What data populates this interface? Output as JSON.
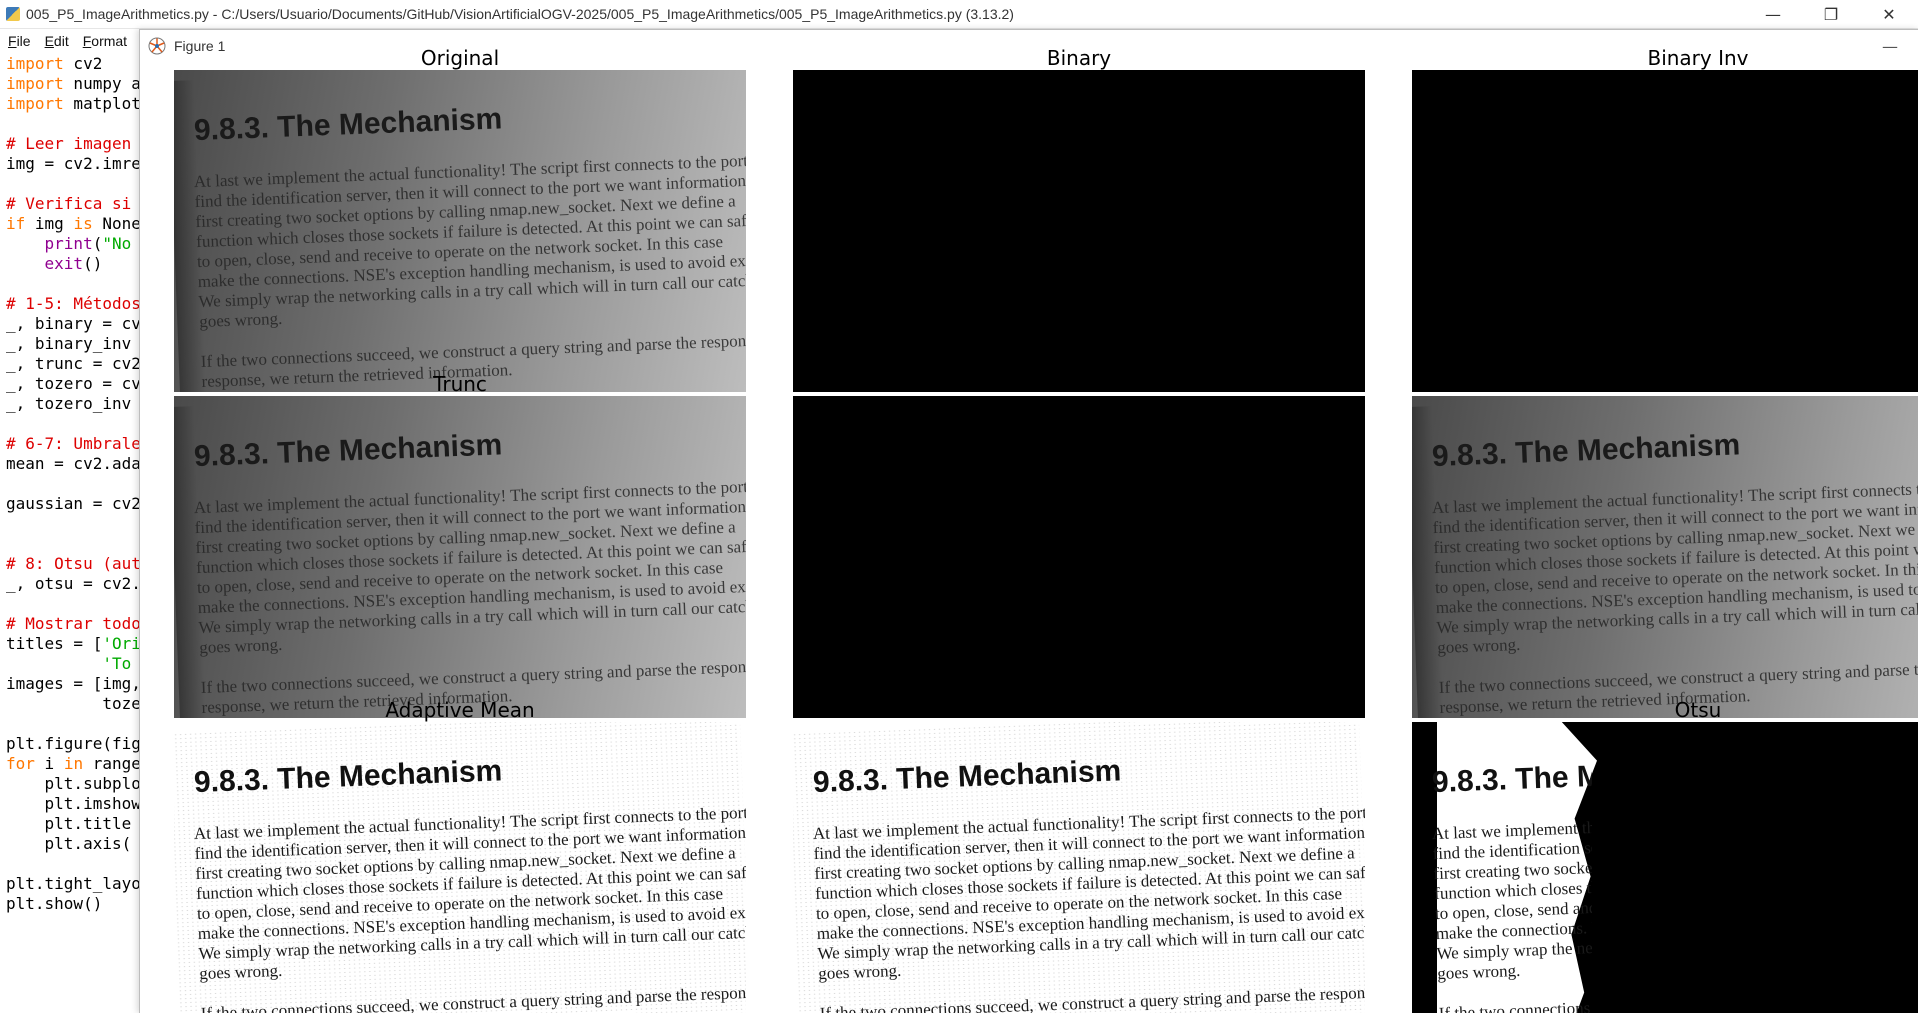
{
  "editor": {
    "title": "005_P5_ImageArithmetics.py - C:/Users/Usuario/Documents/GitHub/VisionArtificialOGV-2025/005_P5_ImageArithmetics/005_P5_ImageArithmetics.py (3.13.2)",
    "menu": [
      "File",
      "Edit",
      "Format"
    ],
    "controls": {
      "minimize": "—",
      "restore": "❐",
      "close": "✕"
    },
    "code": [
      {
        "kw": "import",
        "rest": " cv2"
      },
      {
        "kw": "import",
        "rest": " numpy a"
      },
      {
        "kw": "import",
        "rest": " matplot"
      },
      {
        "comment": "# Leer imagen"
      },
      {
        "text": "img = cv2.imre"
      },
      {
        "comment": "# Verifica si"
      },
      {
        "kw": "if",
        "rest": " img ",
        "kw2": "is",
        "rest2": " None"
      },
      {
        "indent": "    ",
        "bi": "print",
        "paren": "(",
        "str": "\"No"
      },
      {
        "indent": "    ",
        "bi": "exit",
        "rest": "()"
      },
      {
        "comment": "# 1-5: Métodos"
      },
      {
        "text": "_, binary = cv"
      },
      {
        "text": "_, binary_inv"
      },
      {
        "text": "_, trunc = cv2"
      },
      {
        "text": "_, tozero = cv"
      },
      {
        "text": "_, tozero_inv"
      },
      {
        "comment": "# 6-7: Umbrale"
      },
      {
        "text": "mean = cv2.ada"
      },
      {
        "text": "gaussian = cv2"
      },
      {
        "comment": "# 8: Otsu (aut"
      },
      {
        "text": "_, otsu = cv2."
      },
      {
        "comment": "# Mostrar todo"
      },
      {
        "text": "titles = [",
        "str": "'Ori"
      },
      {
        "indent": "          ",
        "str": "'To"
      },
      {
        "text": "images = [img,"
      },
      {
        "text": "          toze"
      },
      {
        "text": "plt.figure(fig"
      },
      {
        "kw": "for",
        "rest": " i ",
        "kw2": "in",
        "rest2": " range"
      },
      {
        "text": "    plt.subplo"
      },
      {
        "text": "    plt.imshow"
      },
      {
        "text": "    plt.title"
      },
      {
        "text": "    plt.axis("
      },
      {
        "text": "plt.tight_layo"
      },
      {
        "text": "plt.show()"
      }
    ]
  },
  "figure": {
    "title": "Figure 1",
    "minimize": "—",
    "subplots": [
      {
        "title": "Original",
        "style": "gray"
      },
      {
        "title": "Binary",
        "style": "black"
      },
      {
        "title": "Binary Inv",
        "style": "black"
      },
      {
        "title": "Trunc",
        "style": "gray"
      },
      {
        "title": "",
        "style": "black"
      },
      {
        "title": "",
        "style": "gray"
      },
      {
        "title": "Adaptive Mean",
        "style": "white"
      },
      {
        "title": "",
        "style": "white"
      },
      {
        "title": "Otsu",
        "style": "otsu"
      }
    ],
    "page_text": {
      "heading": "9.8.3. The Mechanism",
      "lines": [
        "At last we implement the actual functionality! The script first connects to the port",
        "find the identification server, then it will connect to the port we want information",
        "first creating two socket options by calling nmap.new_socket. Next we define a",
        "function which closes those sockets if failure is detected. At this point we can safely",
        "to open, close, send and receive to operate on the network socket. In this case",
        "make the connections. NSE's exception handling mechanism, is used to avoid excessive",
        "We simply wrap the networking calls in a try call which will in turn call our catch",
        "goes wrong.",
        "",
        "If the two connections succeed, we construct a query string and parse the response. If we",
        "response, we return the retrieved information."
      ]
    }
  }
}
